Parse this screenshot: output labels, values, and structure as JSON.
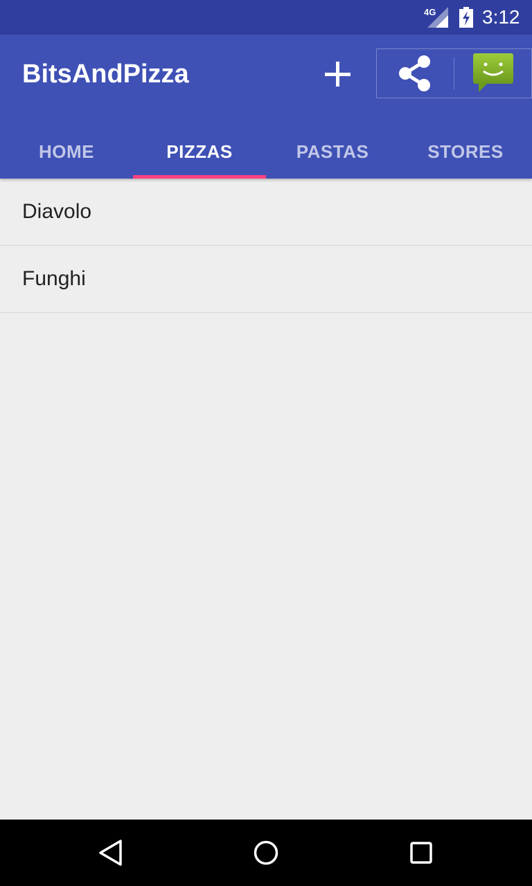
{
  "status_bar": {
    "network": "4G",
    "time": "3:12",
    "icons": [
      "signal-icon",
      "battery-icon"
    ]
  },
  "app_bar": {
    "title": "BitsAndPizza",
    "actions": [
      "add-icon",
      "share-icon",
      "chat-icon"
    ],
    "colors": {
      "primary": "#3f51b5",
      "primary_dark": "#303f9f",
      "accent": "#ff4081"
    }
  },
  "tabs": [
    {
      "label": "HOME",
      "active": false
    },
    {
      "label": "PIZZAS",
      "active": true
    },
    {
      "label": "PASTAS",
      "active": false
    },
    {
      "label": "STORES",
      "active": false
    }
  ],
  "list": {
    "items": [
      "Diavolo",
      "Funghi"
    ]
  },
  "nav_bar": {
    "buttons": [
      "back-icon",
      "home-icon",
      "recents-icon"
    ]
  }
}
